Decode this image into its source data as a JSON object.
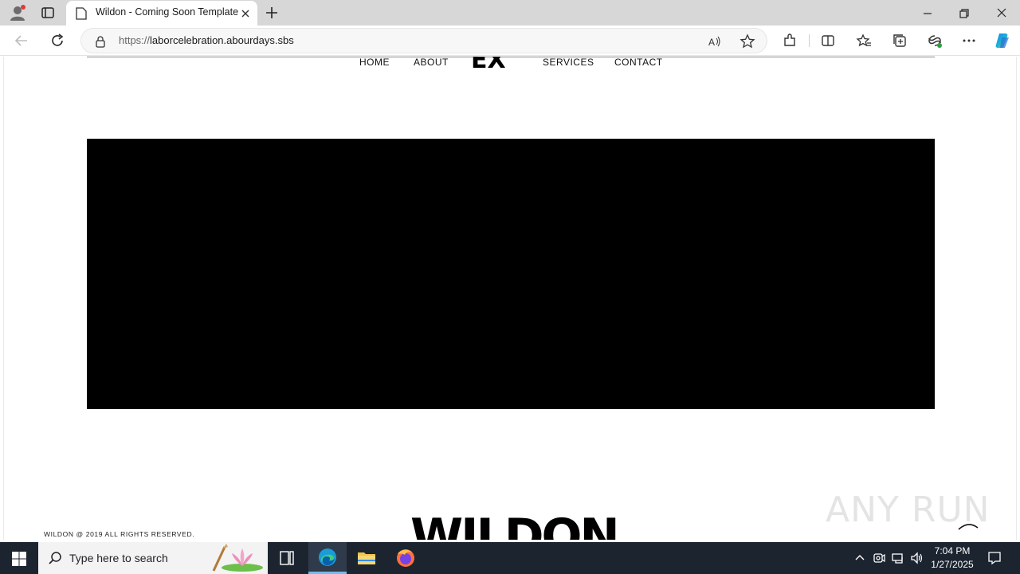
{
  "browser": {
    "tab_title": "Wildon - Coming Soon Template",
    "url_scheme": "https://",
    "url_host": "laborcelebration.abourdays.sbs"
  },
  "site": {
    "nav": {
      "home": "HOME",
      "about": "ABOUT",
      "services": "SERVICES",
      "contact": "CONTACT"
    },
    "logo_text": "EX",
    "brand_word": "WILDON",
    "copyright": "WILDON @ 2019 ALL RIGHTS RESERVED."
  },
  "watermark": "ANY RUN",
  "taskbar": {
    "search_placeholder": "Type here to search",
    "time": "7:04 PM",
    "date": "1/27/2025"
  },
  "colors": {
    "hero_background": "#000000",
    "taskbar": "#1c2430",
    "edge_accent": "#76b9ed"
  }
}
